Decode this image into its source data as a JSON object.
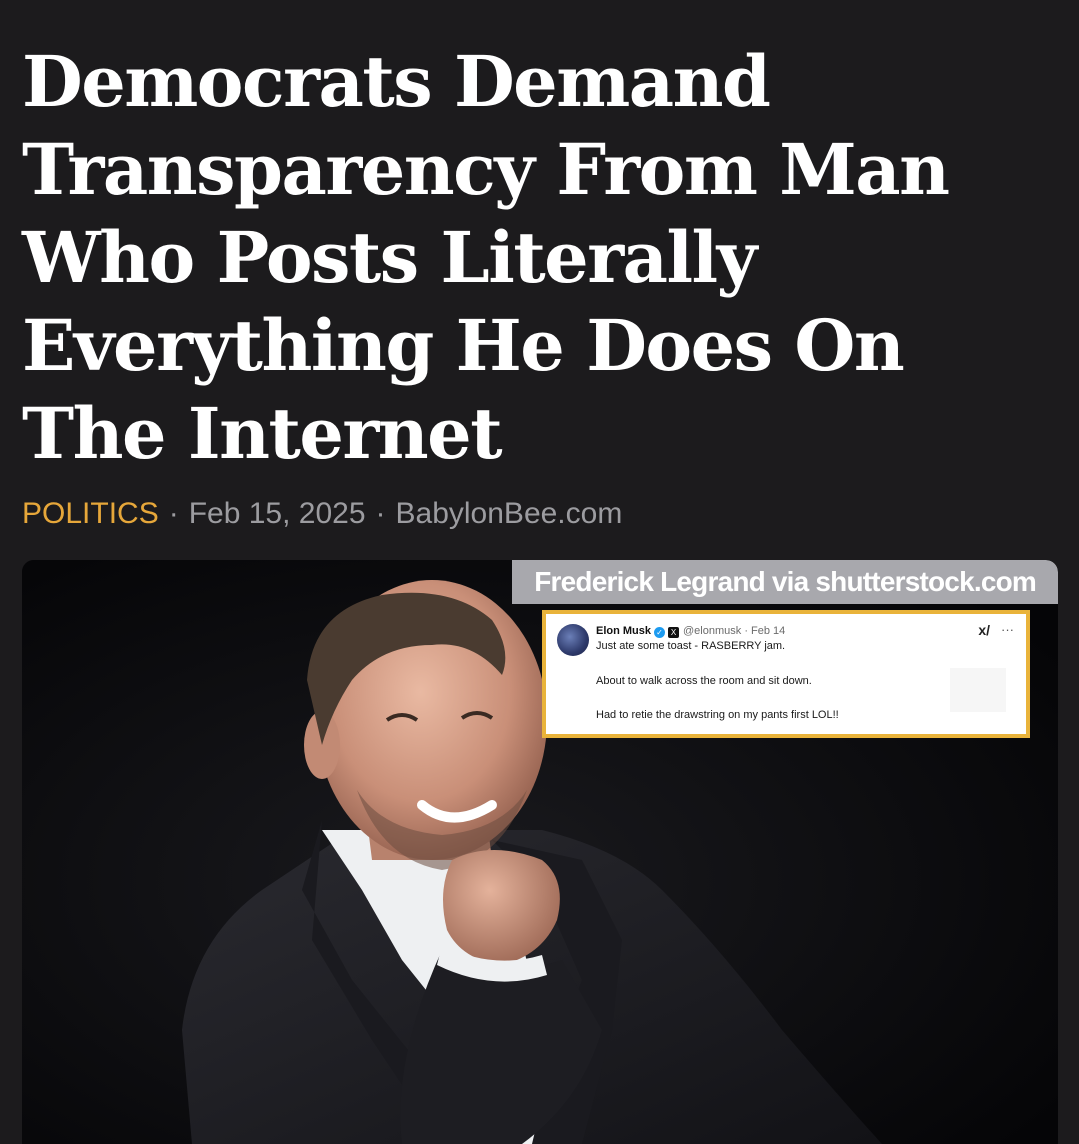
{
  "article": {
    "headline": "Democrats Demand Transparency From Man Who Posts Literally Everything He Does On The Internet",
    "category": "POLITICS",
    "separator": "·",
    "date": "Feb 15, 2025",
    "source": "BabylonBee.com"
  },
  "image": {
    "credit": "Frederick Legrand via shutterstock.com",
    "subject": "smiling man in dark suit, hand on chin"
  },
  "tweet": {
    "name": "Elon Musk",
    "handle": "@elonmusk · Feb 14",
    "grok_icon": "x-slash-icon",
    "more_icon": "···",
    "lines": [
      "Just ate some toast - RASBERRY jam.",
      "About to walk across the room and sit down.",
      "Had to retie the drawstring on my pants first LOL!!"
    ],
    "verified_color": "#1d9bf0",
    "border_color": "#e9b33a"
  },
  "colors": {
    "background": "#1c1b1d",
    "headline": "#ffffff",
    "category": "#e6a73a",
    "meta": "#9c9ca0",
    "credit_bg": "#a8a8ad"
  }
}
